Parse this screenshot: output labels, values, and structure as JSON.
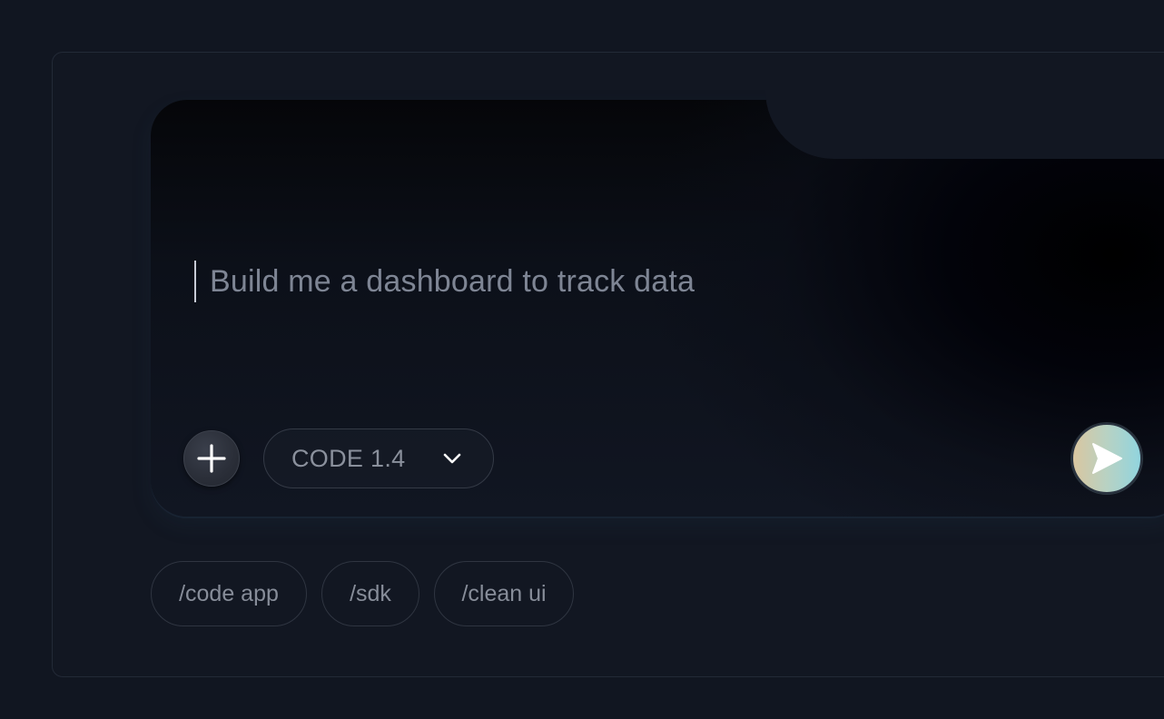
{
  "prompt": {
    "placeholder": "Build me a dashboard to track data"
  },
  "toolbar": {
    "add_icon": "plus-icon",
    "model_label": "CODE 1.4",
    "model_icon": "chevron-down-icon",
    "send_icon": "send-icon"
  },
  "suggestions": [
    {
      "label": "/code app"
    },
    {
      "label": "/sdk"
    },
    {
      "label": "/clean ui"
    }
  ],
  "colors": {
    "background": "#111621",
    "send_gradient_start": "#d9c6a0",
    "send_gradient_end": "#91d4de",
    "placeholder_text": "#7e8594"
  }
}
